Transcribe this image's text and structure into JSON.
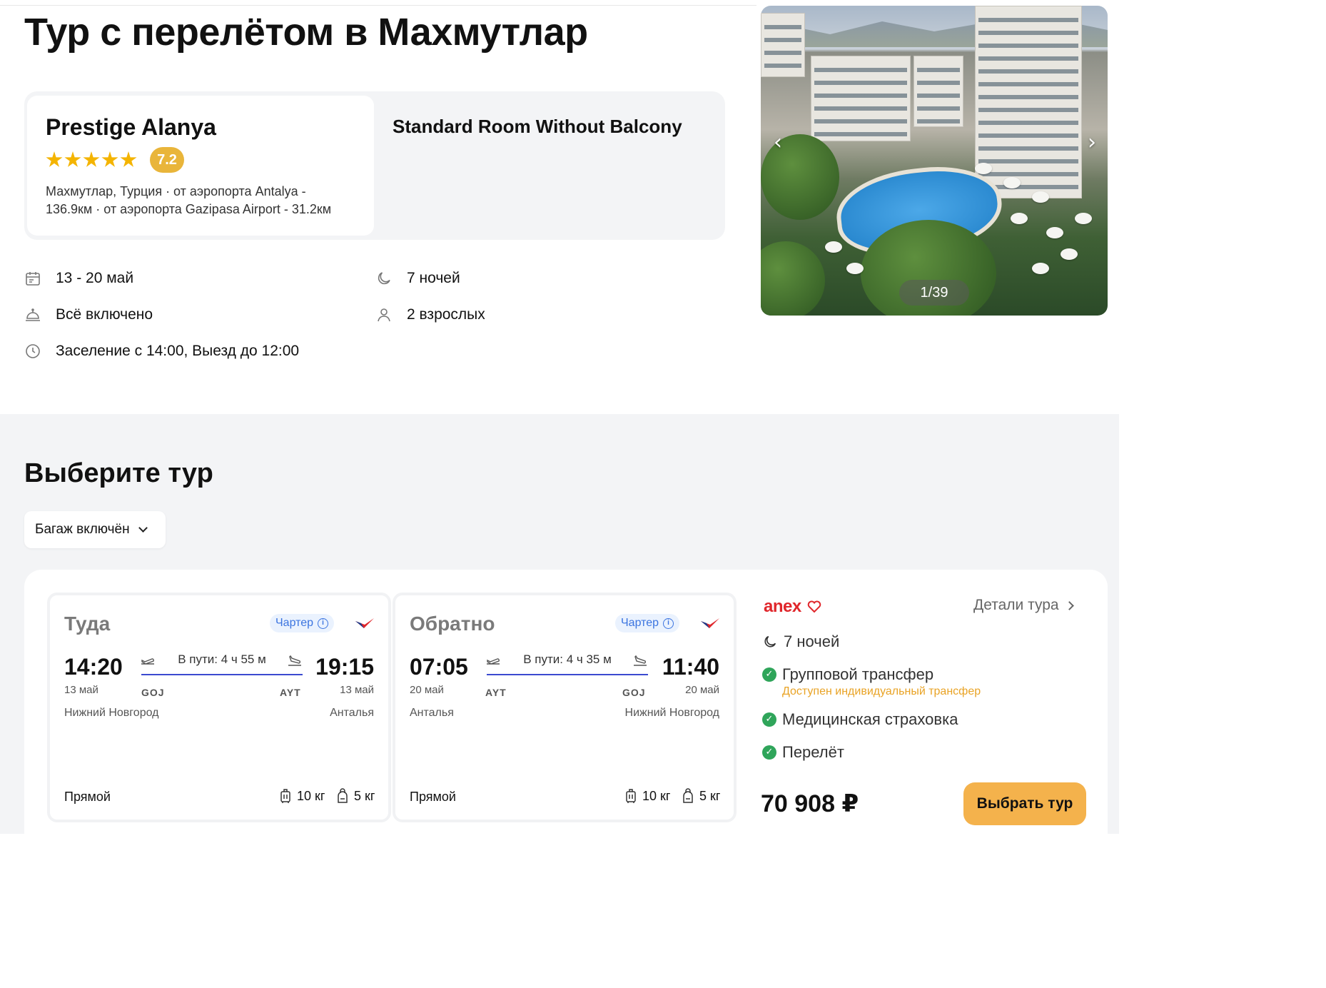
{
  "page_title": "Тур с перелётом в Махмутлар",
  "hotel": {
    "name": "Prestige Alanya",
    "stars": 5,
    "rating": "7.2",
    "location_line1": "Махмутлар, Турция · от аэропорта Antalya -",
    "location_line2": "136.9км · от аэропорта Gazipasa Airport - 31.2км",
    "room_type": "Standard Room Without Balcony"
  },
  "info": {
    "dates": "13 - 20 май",
    "nights": "7 ночей",
    "meal": "Всё включено",
    "guests": "2 взрослых",
    "checkin": "Заселение с 14:00, Выезд до 12:00"
  },
  "gallery": {
    "counter": "1/39",
    "prev_icon": "chevron-left-icon",
    "next_icon": "chevron-right-icon"
  },
  "tour_section": {
    "title": "Выберите тур",
    "filter_label": "Багаж включён"
  },
  "flights": [
    {
      "direction": "Туда",
      "badge": "Чартер",
      "dep_time": "14:20",
      "dep_date": "13 май",
      "dep_city": "Нижний Новгород",
      "dep_airport": "GOJ",
      "arr_time": "19:15",
      "arr_date": "13 май",
      "arr_city": "Анталья",
      "arr_airport": "AYT",
      "duration": "В пути: 4 ч 55 м",
      "stops": "Прямой",
      "baggage": "10 кг",
      "hand_luggage": "5 кг"
    },
    {
      "direction": "Обратно",
      "badge": "Чартер",
      "dep_time": "07:05",
      "dep_date": "20 май",
      "dep_city": "Анталья",
      "dep_airport": "AYT",
      "arr_time": "11:40",
      "arr_date": "20 май",
      "arr_city": "Нижний Новгород",
      "arr_airport": "GOJ",
      "duration": "В пути: 4 ч 35 м",
      "stops": "Прямой",
      "baggage": "10 кг",
      "hand_luggage": "5 кг"
    }
  ],
  "offer": {
    "operator": "anex",
    "details_link": "Детали тура",
    "nights": "7 ночей",
    "transfer": "Групповой трансфер",
    "transfer_note": "Доступен индивидуальный трансфер",
    "insurance": "Медицинская страховка",
    "flight": "Перелёт",
    "price": "70 908 ₽",
    "select_button": "Выбрать тур"
  },
  "colors": {
    "accent": "#f4b24c",
    "rating": "#e9b53a",
    "check": "#2fa55a",
    "charter": "#3b74e0",
    "operator": "#e0262b"
  }
}
